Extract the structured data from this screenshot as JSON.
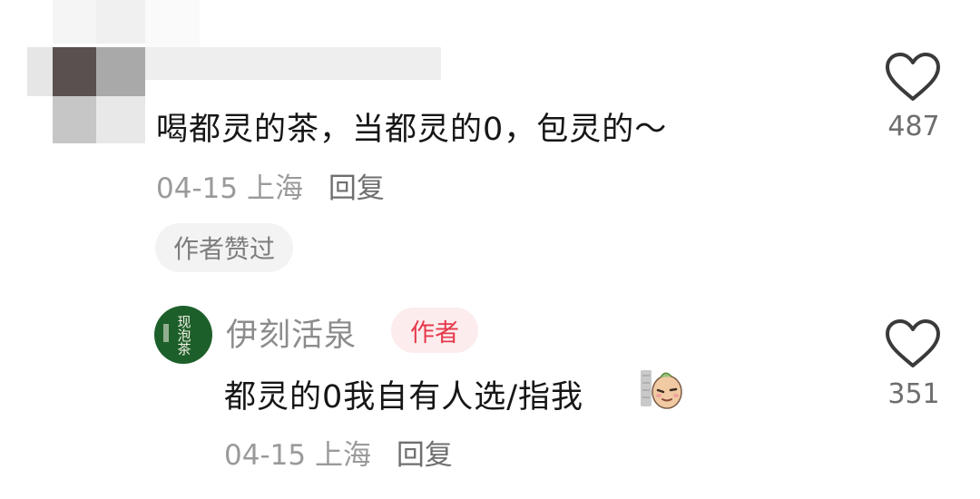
{
  "comment1": {
    "text": "喝都灵的茶，当都灵的0，包灵的～",
    "date": "04-15",
    "location": "上海",
    "reply_label": "回复",
    "like_count": "487",
    "liked_by_author_label": "作者赞过"
  },
  "reply": {
    "username": "伊刻活泉",
    "author_badge": "作者",
    "avatar_text": "现泡茶",
    "text": "都灵的0我自有人选/指我",
    "date": "04-15",
    "location": "上海",
    "reply_label": "回复",
    "like_count": "351"
  },
  "colors": {
    "badge_red": "#e53a4b",
    "avatar_green": "#1d5f2a",
    "meta_gray": "#9a9a9a"
  },
  "icons": {
    "like": "heart-outline-icon",
    "emoji": "dog-face-emoji"
  }
}
